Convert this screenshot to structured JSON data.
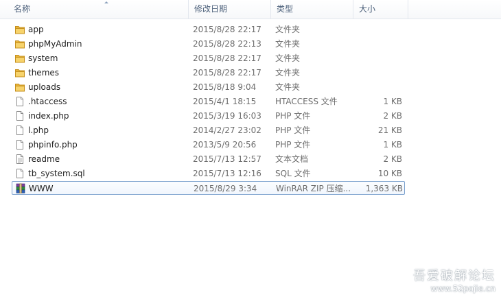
{
  "columns": {
    "name": "名称",
    "modified": "修改日期",
    "type": "类型",
    "size": "大小"
  },
  "files": [
    {
      "name": "app",
      "modified": "2015/8/28 22:17",
      "type": "文件夹",
      "size": "",
      "icon": "folder-icon"
    },
    {
      "name": "phpMyAdmin",
      "modified": "2015/8/28 22:13",
      "type": "文件夹",
      "size": "",
      "icon": "folder-icon"
    },
    {
      "name": "system",
      "modified": "2015/8/28 22:17",
      "type": "文件夹",
      "size": "",
      "icon": "folder-icon"
    },
    {
      "name": "themes",
      "modified": "2015/8/28 22:17",
      "type": "文件夹",
      "size": "",
      "icon": "folder-icon"
    },
    {
      "name": "uploads",
      "modified": "2015/8/18 9:04",
      "type": "文件夹",
      "size": "",
      "icon": "folder-icon"
    },
    {
      "name": ".htaccess",
      "modified": "2015/4/1 18:15",
      "type": "HTACCESS 文件",
      "size": "1 KB",
      "icon": "file-icon"
    },
    {
      "name": "index.php",
      "modified": "2015/3/19 16:03",
      "type": "PHP 文件",
      "size": "2 KB",
      "icon": "file-icon"
    },
    {
      "name": "l.php",
      "modified": "2014/2/27 23:02",
      "type": "PHP 文件",
      "size": "21 KB",
      "icon": "file-icon"
    },
    {
      "name": "phpinfo.php",
      "modified": "2013/5/9 20:56",
      "type": "PHP 文件",
      "size": "1 KB",
      "icon": "file-icon"
    },
    {
      "name": "readme",
      "modified": "2015/7/13 12:57",
      "type": "文本文档",
      "size": "2 KB",
      "icon": "text-file-icon"
    },
    {
      "name": "tb_system.sql",
      "modified": "2015/7/13 12:16",
      "type": "SQL 文件",
      "size": "10 KB",
      "icon": "file-icon"
    },
    {
      "name": "WWW",
      "modified": "2015/8/29 3:34",
      "type": "WinRAR ZIP 压缩...",
      "size": "1,363 KB",
      "icon": "winrar-archive-icon",
      "selected": true
    }
  ],
  "watermark": {
    "line1": "吾爱破解论坛",
    "line2": "www.52pojie.cn"
  }
}
